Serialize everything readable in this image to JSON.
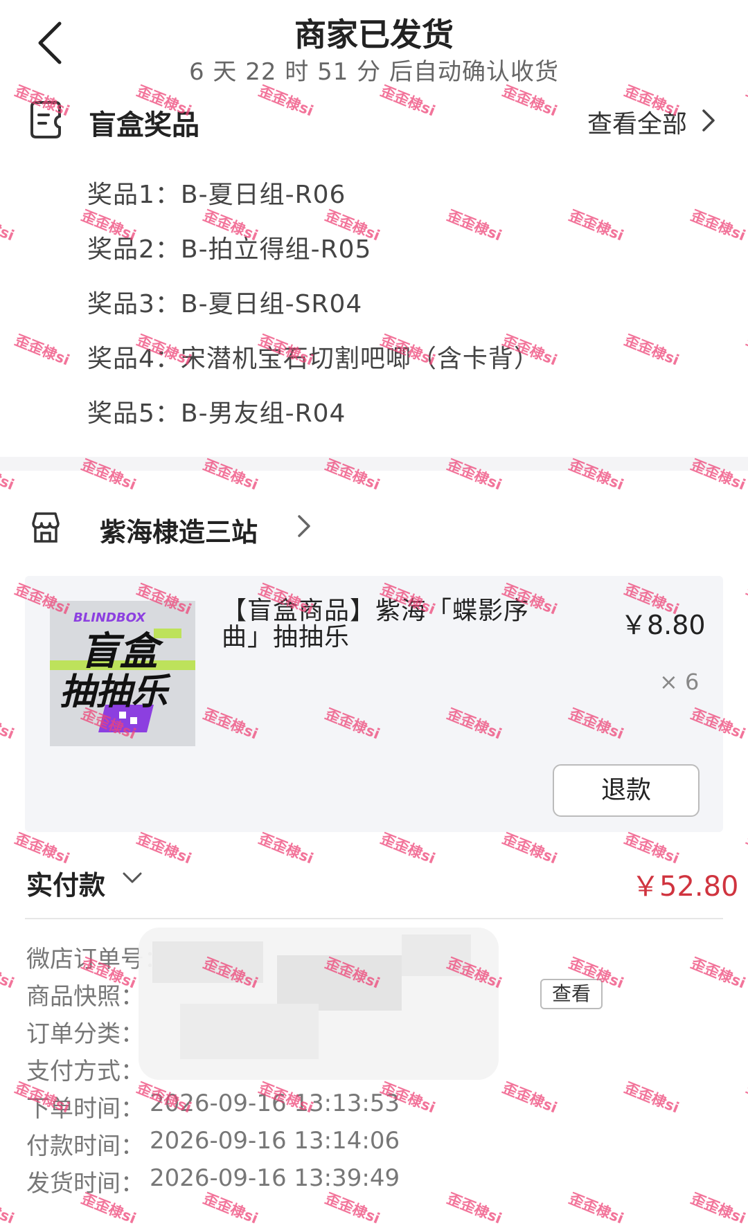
{
  "header": {
    "title": "商家已发货",
    "subtitle": "6 天 22 时 51 分  后自动确认收货"
  },
  "prizes": {
    "heading": "盲盒奖品",
    "view_all": "查看全部",
    "items": [
      "奖品1：B-夏日组-R06",
      "奖品2：B-拍立得组-R05",
      "奖品3：B-夏日组-SR04",
      "奖品4：宋潜机宝石切割吧唧（含卡背）",
      "奖品5：B-男友组-R04"
    ]
  },
  "store": {
    "name": "紫海棣造三站"
  },
  "product": {
    "thumb_brand": "BLINDBOX",
    "thumb_title_1": "盲盒",
    "thumb_title_2": "抽抽乐",
    "name": "【盲盒商品】紫海「蝶影序曲」抽抽乐",
    "price": "￥8.80",
    "qty": "× 6",
    "refund": "退款"
  },
  "payment": {
    "label": "实付款",
    "amount": "￥52.80"
  },
  "order_info": {
    "order_no": "微店订单号：",
    "snapshot": "商品快照：",
    "snapshot_btn": "查看",
    "category": "订单分类：",
    "pay_method": "支付方式：",
    "order_time_label": "下单时间：",
    "order_time": "2026-09-16 13:13:53",
    "pay_time_label": "付款时间：",
    "pay_time": "2026-09-16 13:14:06",
    "ship_time_label": "发货时间：",
    "ship_time": "2026-09-16 13:39:49"
  },
  "watermark": "歪歪棣si",
  "colors": {
    "accent_red": "#d0343f",
    "watermark": "#ee4678"
  }
}
